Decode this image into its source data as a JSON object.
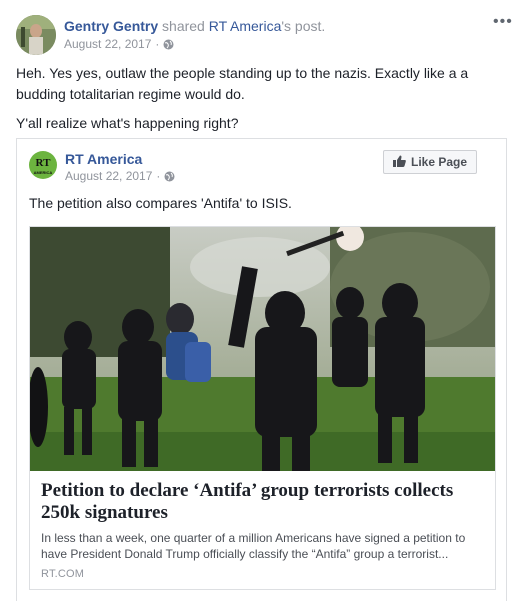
{
  "post": {
    "author": "Gentry Gentry",
    "shared_text": "shared",
    "shared_page": "RT America",
    "shared_suffix": "'s post.",
    "date": "August 22, 2017",
    "privacy_icon": "globe-icon",
    "more_icon": "more-options-icon",
    "more_glyph": "•••",
    "message": [
      "Heh. Yes yes, outlaw the people standing up to the nazis. Exactly like a a budding totalitarian regime would do.",
      "Y'all realize what's happening right?"
    ]
  },
  "shared_post": {
    "page_name": "RT America",
    "logo_text": "RT",
    "logo_sub": "AMERICA",
    "date": "August 22, 2017",
    "like_button_label": "Like Page",
    "text": "The petition also compares 'Antifa' to ISIS.",
    "link": {
      "title": "Petition to declare ‘Antifa’ group terrorists collects 250k signatures",
      "description": "In less than a week, one quarter of a million Americans have signed a petition to have President Donald Trump officially classify the “Antifa” group a terrorist...",
      "domain": "RT.COM"
    }
  },
  "colors": {
    "link_blue": "#365899",
    "meta_gray": "#90949c",
    "rt_green": "#6cb43f",
    "border": "#dddfe2"
  }
}
